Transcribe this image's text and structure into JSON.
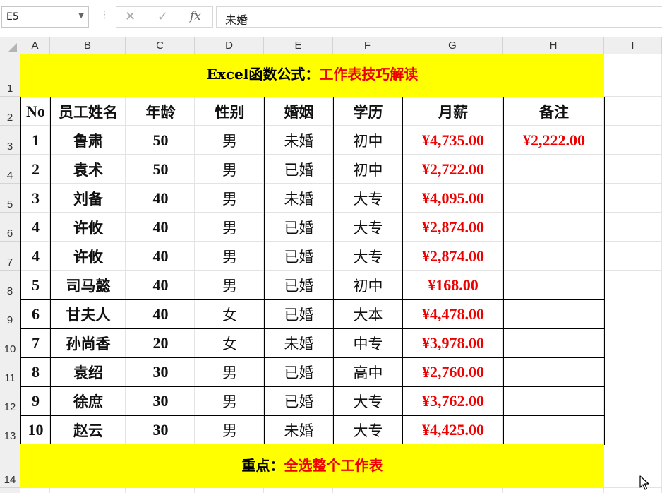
{
  "formula_bar": {
    "name_box": "E5",
    "cancel_icon": "✕",
    "enter_icon": "✓",
    "fx_label": "fx",
    "formula": "未婚"
  },
  "columns": [
    "A",
    "B",
    "C",
    "D",
    "E",
    "F",
    "G",
    "H",
    "I"
  ],
  "rows": [
    "1",
    "2",
    "3",
    "4",
    "5",
    "6",
    "7",
    "8",
    "9",
    "10",
    "11",
    "12",
    "13",
    "14"
  ],
  "title": {
    "part1": "Excel函数公式：",
    "part2": "工作表技巧解读"
  },
  "table": {
    "headers": [
      "No",
      "员工姓名",
      "年龄",
      "性别",
      "婚姻",
      "学历",
      "月薪",
      "备注"
    ],
    "rows": [
      [
        "1",
        "鲁肃",
        "50",
        "男",
        "未婚",
        "初中",
        "¥4,735.00",
        "¥2,222.00"
      ],
      [
        "2",
        "袁术",
        "50",
        "男",
        "已婚",
        "初中",
        "¥2,722.00",
        ""
      ],
      [
        "3",
        "刘备",
        "40",
        "男",
        "未婚",
        "大专",
        "¥4,095.00",
        ""
      ],
      [
        "4",
        "许攸",
        "40",
        "男",
        "已婚",
        "大专",
        "¥2,874.00",
        ""
      ],
      [
        "4",
        "许攸",
        "40",
        "男",
        "已婚",
        "大专",
        "¥2,874.00",
        ""
      ],
      [
        "5",
        "司马懿",
        "40",
        "男",
        "已婚",
        "初中",
        "¥168.00",
        ""
      ],
      [
        "6",
        "甘夫人",
        "40",
        "女",
        "已婚",
        "大本",
        "¥4,478.00",
        ""
      ],
      [
        "7",
        "孙尚香",
        "20",
        "女",
        "未婚",
        "中专",
        "¥3,978.00",
        ""
      ],
      [
        "8",
        "袁绍",
        "30",
        "男",
        "已婚",
        "高中",
        "¥2,760.00",
        ""
      ],
      [
        "9",
        "徐庶",
        "30",
        "男",
        "已婚",
        "大专",
        "¥3,762.00",
        ""
      ],
      [
        "10",
        "赵云",
        "30",
        "男",
        "未婚",
        "大专",
        "¥4,425.00",
        ""
      ]
    ]
  },
  "bottom_banner": {
    "part1": "重点：",
    "part2": "全选整个工作表"
  },
  "colors": {
    "banner": "#ffff00",
    "accent_red": "#ee0000"
  }
}
